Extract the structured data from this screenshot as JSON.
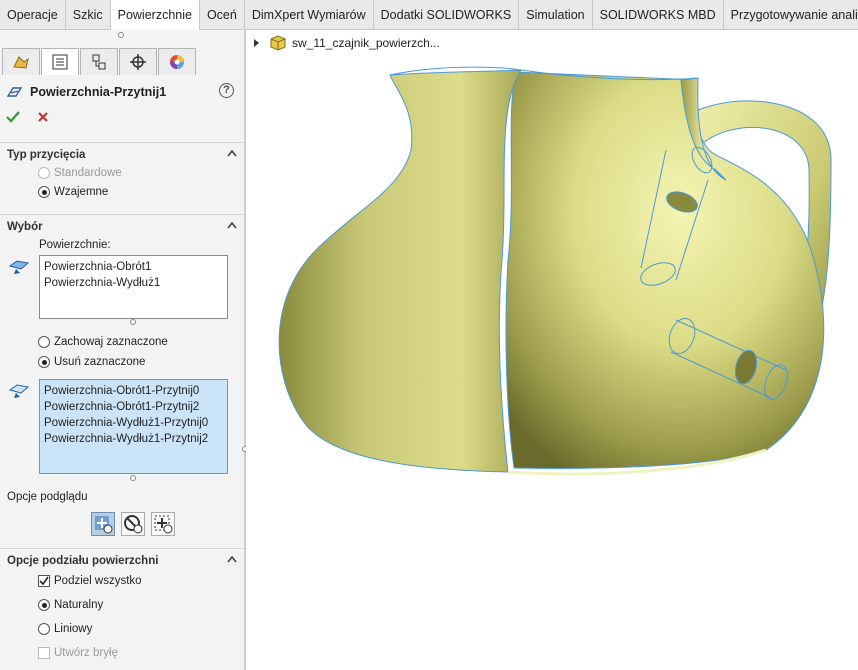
{
  "tabs": [
    "Operacje",
    "Szkic",
    "Powierzchnie",
    "Oceń",
    "DimXpert Wymiarów",
    "Dodatki SOLIDWORKS",
    "Simulation",
    "SOLIDWORKS MBD",
    "Przygotowywanie analizy"
  ],
  "active_tab": "Powierzchnie",
  "feature_title": "Powierzchnia-Przytnij1",
  "trim_type": {
    "header": "Typ przycięcia",
    "options": [
      "Standardowe",
      "Wzajemne"
    ],
    "selected": "Wzajemne"
  },
  "selection": {
    "header": "Wybór",
    "surfaces_label": "Powierzchnie:",
    "surfaces": [
      "Powierzchnia-Obrót1",
      "Powierzchnia-Wydłuż1"
    ],
    "keep_options": [
      "Zachowaj zaznaczone",
      "Usuń zaznaczone"
    ],
    "keep_selected": "Usuń zaznaczone",
    "pieces": [
      "Powierzchnia-Obrót1-Przytnij0",
      "Powierzchnia-Obrót1-Przytnij2",
      "Powierzchnia-Wydłuż1-Przytnij0",
      "Powierzchnia-Wydłuż1-Przytnij2"
    ]
  },
  "preview": {
    "label": "Opcje podglądu"
  },
  "split_options": {
    "header": "Opcje podziału powierzchni",
    "split_all": "Podziel wszystko",
    "split_all_checked": true,
    "natural": "Naturalny",
    "linear": "Liniowy",
    "selected": "Naturalny",
    "create_solid": "Utwórz bryłę"
  },
  "tree": {
    "part_name": "sw_11_czajnik_powierzch..."
  },
  "colors": {
    "accent_blue": "#5b9bd5",
    "model_yellow": "#dcdc86",
    "edge_blue": "#3a9ad9"
  }
}
